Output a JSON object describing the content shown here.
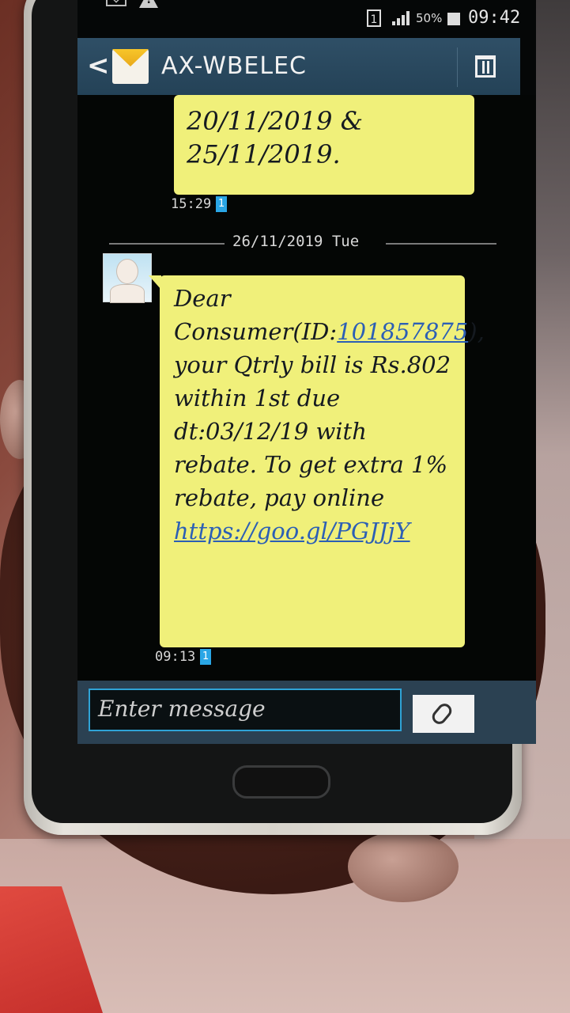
{
  "status_bar": {
    "sim_slot": "1",
    "battery": "50%",
    "time": "09:42"
  },
  "header": {
    "title": "AX-WBELEC"
  },
  "messages": [
    {
      "text_lines": [
        "20/11/2019 &",
        "25/11/2019."
      ],
      "time": "15:29",
      "sim": "1"
    },
    {
      "date_divider": "26/11/2019 Tue",
      "text_before_id": "Dear Consumer(ID:",
      "consumer_id": "101857875",
      "text_after_id": "), your Qtrly bill is Rs.802 within 1st due dt:03/12/19 with rebate. To get extra 1% rebate, pay online ",
      "link": "https://goo.gl/PGJJjY",
      "time": "09:13",
      "sim": "1"
    }
  ],
  "composer": {
    "placeholder": "Enter message"
  },
  "colors": {
    "bubble": "#f0f07a",
    "header": "#2f4f66",
    "link": "#2c5fb5",
    "input_border": "#2fa3d6"
  },
  "icons": [
    "mail-icon",
    "warning-icon",
    "signal-icon",
    "battery-icon",
    "back-icon",
    "sms-app-icon",
    "trash-icon",
    "paperclip-icon"
  ]
}
